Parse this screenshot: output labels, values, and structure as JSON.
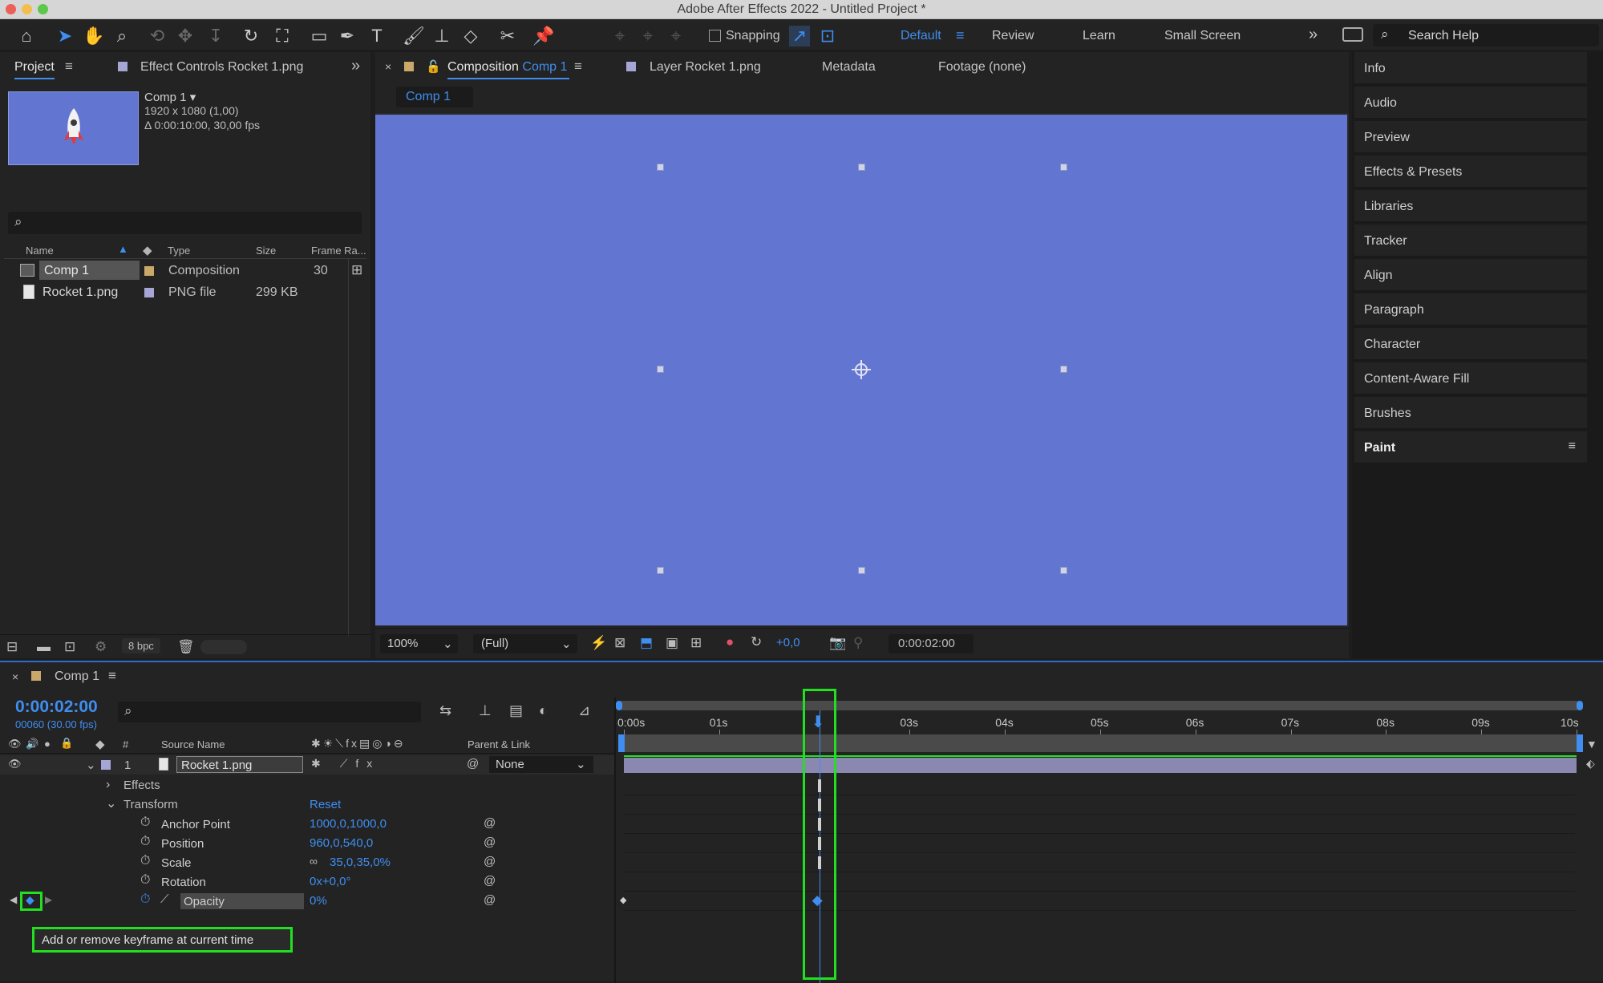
{
  "app": {
    "title": "Adobe After Effects 2022 - Untitled Project *"
  },
  "toolbar": {
    "snapping_label": "Snapping",
    "workspaces": [
      "Default",
      "Review",
      "Learn",
      "Small Screen"
    ],
    "search_placeholder": "Search Help",
    "active_tool": "selection-tool"
  },
  "project_panel": {
    "tabs": {
      "project": "Project",
      "effect_controls": "Effect Controls Rocket 1.png"
    },
    "comp_name": "Comp 1 ▾",
    "comp_resolution": "1920 x 1080 (1,00)",
    "comp_duration": "Δ 0:00:10:00, 30,00 fps",
    "columns": {
      "name": "Name",
      "type": "Type",
      "size": "Size",
      "frame_rate": "Frame Ra..."
    },
    "items": [
      {
        "name": "Comp 1",
        "type": "Composition",
        "size": "",
        "frame_rate": "30",
        "label_color": "#c9a86a"
      },
      {
        "name": "Rocket 1.png",
        "type": "PNG file",
        "size": "299 KB",
        "frame_rate": "",
        "label_color": "#a6a6d6"
      }
    ],
    "bpc": "8 bpc"
  },
  "viewer": {
    "tabs": {
      "composition_prefix": "Composition",
      "composition_name": "Comp 1",
      "layer": "Layer Rocket 1.png",
      "metadata": "Metadata",
      "footage": "Footage (none)"
    },
    "breadcrumb": "Comp 1",
    "zoom": "100%",
    "resolution": "(Full)",
    "exposure": "+0,0",
    "timecode": "0:00:02:00",
    "canvas_color": "#6275d0"
  },
  "right_panels": [
    "Info",
    "Audio",
    "Preview",
    "Effects & Presets",
    "Libraries",
    "Tracker",
    "Align",
    "Paragraph",
    "Character",
    "Content-Aware Fill",
    "Brushes",
    "Paint"
  ],
  "timeline": {
    "comp_tab": "Comp 1",
    "current_time": "0:00:02:00",
    "frame_info": "00060 (30.00 fps)",
    "headers": {
      "num": "#",
      "source_name": "Source Name",
      "parent_link": "Parent & Link"
    },
    "layer": {
      "index": "1",
      "name": "Rocket 1.png",
      "parent": "None"
    },
    "groups": {
      "effects": "Effects",
      "transform": "Transform",
      "reset": "Reset"
    },
    "properties": [
      {
        "name": "Anchor Point",
        "value": "1000,0,1000,0"
      },
      {
        "name": "Position",
        "value": "960,0,540,0"
      },
      {
        "name": "Scale",
        "value": "35,0,35,0%"
      },
      {
        "name": "Rotation",
        "value": "0x+0,0°"
      },
      {
        "name": "Opacity",
        "value": "0%"
      }
    ],
    "ruler": [
      "0:00s",
      "01s",
      "03s",
      "04s",
      "05s",
      "06s",
      "07s",
      "08s",
      "09s",
      "10s"
    ],
    "playhead_seconds": 2,
    "duration_seconds": 10,
    "tooltip": "Add or remove keyframe at current time"
  },
  "colors": {
    "accent": "#3f8ef0",
    "highlight": "#22e01f",
    "layer_bar": "#8a88b0"
  }
}
